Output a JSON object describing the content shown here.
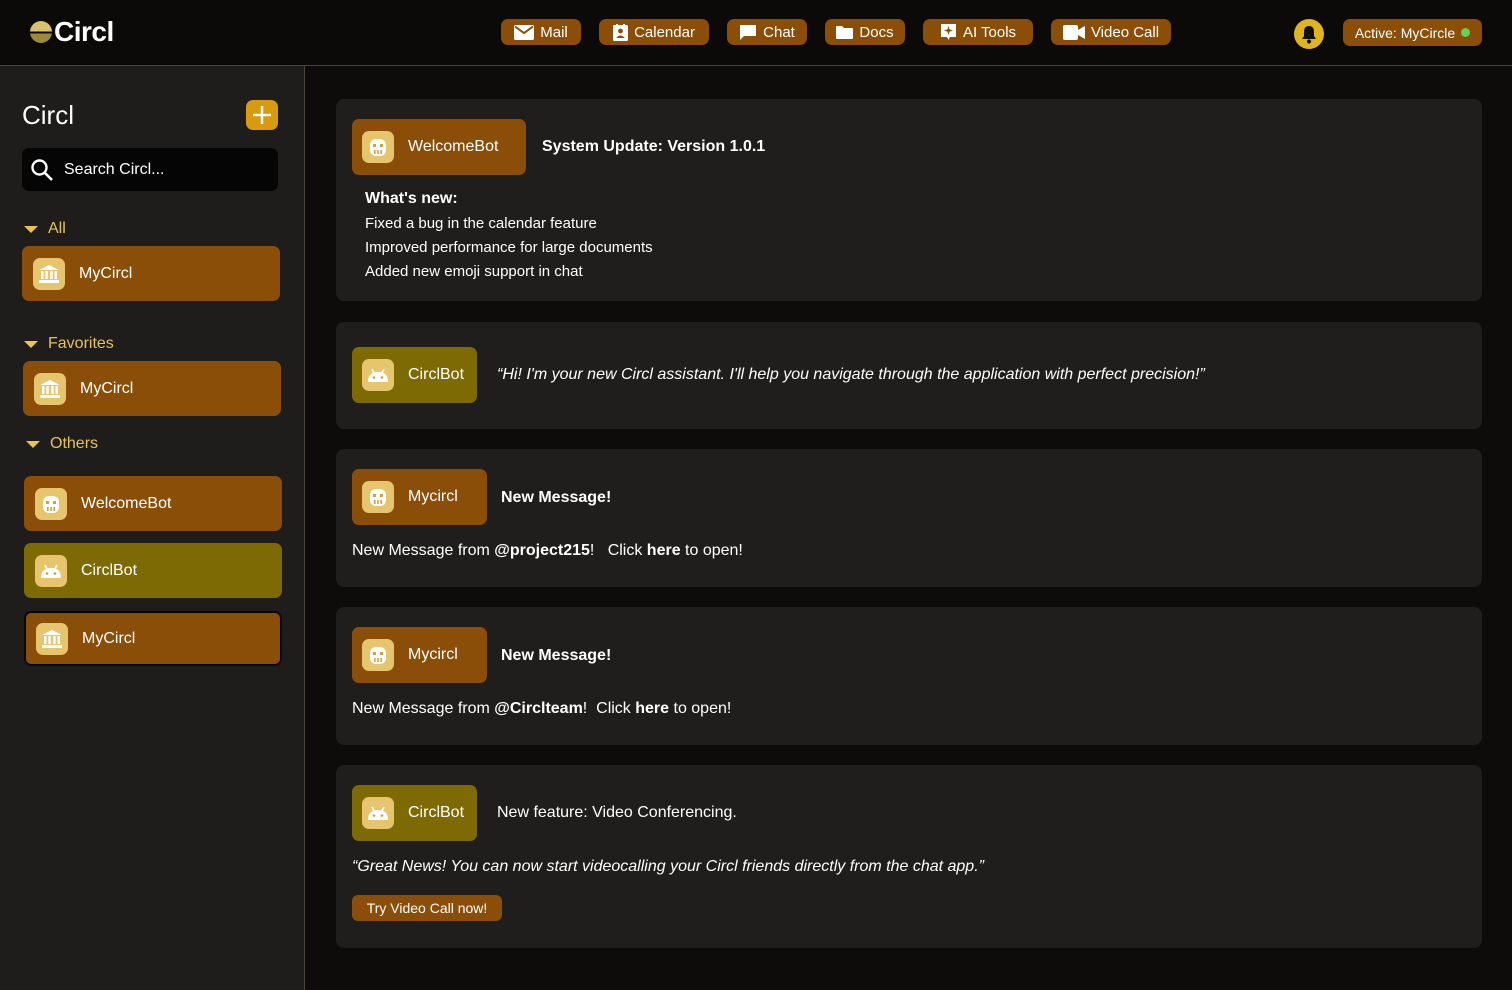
{
  "app": {
    "logo_text": "Circl"
  },
  "nav": [
    {
      "label": "Mail",
      "icon": "mail-icon"
    },
    {
      "label": "Calendar",
      "icon": "calendar-icon"
    },
    {
      "label": "Chat",
      "icon": "chat-icon"
    },
    {
      "label": "Docs",
      "icon": "folder-icon"
    },
    {
      "label": "AI Tools",
      "icon": "ai-tools-icon"
    },
    {
      "label": "Video Call",
      "icon": "video-icon"
    }
  ],
  "status": {
    "label": "Active: MyCircle",
    "dot_color": "#5fd35a"
  },
  "colors": {
    "accent_orange": "#8a4e08",
    "accent_olive": "#7d6a04",
    "section_text": "#e8c256",
    "add_button": "#d89b10"
  },
  "sidebar": {
    "title": "Circl",
    "search_placeholder": "Search Circl...",
    "sections": [
      {
        "label": "All",
        "items": [
          {
            "label": "MyCircl",
            "icon": "bank-icon"
          }
        ]
      },
      {
        "label": "Favorites",
        "items": [
          {
            "label": "MyCircl",
            "icon": "bank-icon"
          }
        ]
      },
      {
        "label": "Others",
        "items": [
          {
            "label": "WelcomeBot",
            "icon": "robot-face-icon"
          },
          {
            "label": "CirclBot",
            "icon": "android-icon"
          },
          {
            "label": "MyCircl",
            "icon": "bank-icon"
          }
        ]
      }
    ]
  },
  "feed": {
    "card1": {
      "sender": "WelcomeBot",
      "title": "System Update: Version 1.0.1",
      "subheading": "What's new:",
      "items": [
        "Fixed a bug in the calendar feature",
        "Improved performance for large documents",
        "Added new emoji support in chat"
      ]
    },
    "card2": {
      "sender": "CirclBot",
      "quote": "“Hi! I'm your new Circl assistant. I'll help you navigate through the application with perfect precision!”"
    },
    "card3": {
      "sender": "Mycircl",
      "title": "New Message!",
      "prefix": "New Message from ",
      "handle": "@project215",
      "suffix1": "!   Click ",
      "link": "here",
      "suffix2": " to open!"
    },
    "card4": {
      "sender": "Mycircl",
      "title": "New Message!",
      "prefix": "New Message from ",
      "handle": "@Circlteam",
      "suffix1": "!  Click ",
      "link": "here",
      "suffix2": " to open!"
    },
    "card5": {
      "sender": "CirclBot",
      "title": "New feature: Video Conferencing.",
      "quote": "“Great News! You can now start videocalling your Circl friends directly from the chat app.”",
      "cta": "Try Video Call now!"
    }
  }
}
